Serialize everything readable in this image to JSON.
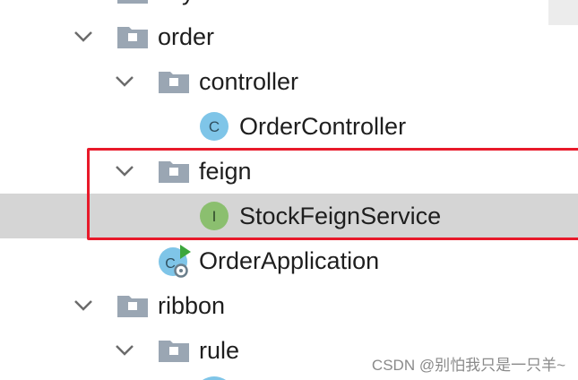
{
  "tree": {
    "items": [
      {
        "label": "zzy",
        "type": "package",
        "expanded": true
      },
      {
        "label": "order",
        "type": "package",
        "expanded": true
      },
      {
        "label": "controller",
        "type": "package",
        "expanded": true
      },
      {
        "label": "OrderController",
        "type": "class",
        "icon": "class-c-icon"
      },
      {
        "label": "feign",
        "type": "package",
        "expanded": true
      },
      {
        "label": "StockFeignService",
        "type": "interface",
        "icon": "interface-i-icon",
        "selected": true
      },
      {
        "label": "OrderApplication",
        "type": "spring-boot-main-class",
        "icon": "run-class-icon"
      },
      {
        "label": "ribbon",
        "type": "package",
        "expanded": true
      },
      {
        "label": "rule",
        "type": "package",
        "expanded": true
      }
    ]
  },
  "icons": {
    "class_letter": "C",
    "interface_letter": "I"
  },
  "colors": {
    "selected_row": "#d5d5d5",
    "highlight_border": "#e8192a",
    "folder": "#9aa6b3",
    "class_icon": "#7fc5e8",
    "interface_icon": "#8bbf6f",
    "run_arrow": "#3ca63c"
  },
  "watermark": "CSDN @别怕我只是一只羊~"
}
